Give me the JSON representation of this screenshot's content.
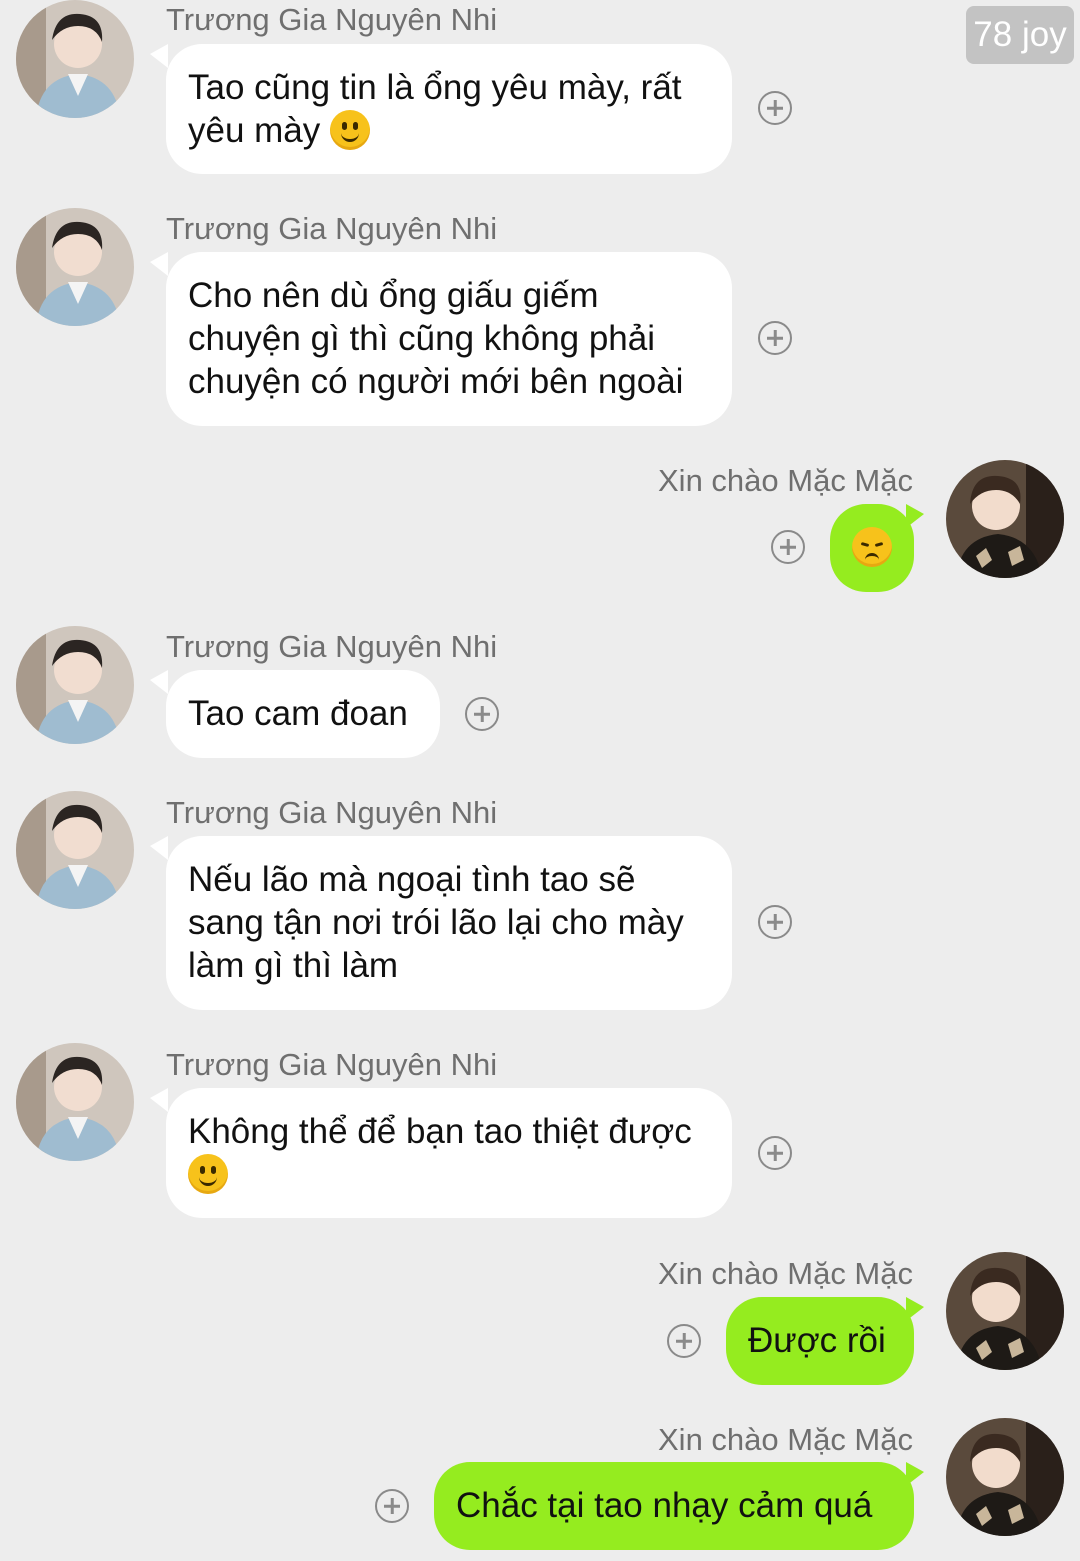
{
  "watermark": "78 joy",
  "colors": {
    "background": "#ededed",
    "incoming_bubble": "#ffffff",
    "outgoing_bubble": "#95ec1f"
  },
  "contacts": {
    "other": "Trương Gia Nguyên Nhi",
    "self": "Xin chào Mặc Mặc"
  },
  "messages": [
    {
      "sender": "Trương Gia Nguyên Nhi",
      "lines": [
        "Tao cũng tin là ổng yêu mày, rất",
        "yêu mày"
      ],
      "emoji": "slightly-smiling-face"
    },
    {
      "sender": "Trương Gia Nguyên Nhi",
      "lines": [
        "Cho nên dù ổng giấu giếm",
        "chuyện gì thì cũng không phải",
        "chuyện có người mới bên ngoài"
      ]
    },
    {
      "sender": "Xin chào Mặc Mặc",
      "lines": [],
      "emoji": "pensive-face"
    },
    {
      "sender": "Trương Gia Nguyên Nhi",
      "lines": [
        "Tao cam đoan"
      ]
    },
    {
      "sender": "Trương Gia Nguyên Nhi",
      "lines": [
        "Nếu lão mà ngoại tình tao sẽ",
        "sang tận nơi trói lão lại cho mày",
        "làm gì thì làm"
      ]
    },
    {
      "sender": "Trương Gia Nguyên Nhi",
      "lines": [
        "Không thể để bạn tao thiệt được"
      ],
      "emoji": "slightly-smiling-face"
    },
    {
      "sender": "Xin chào Mặc Mặc",
      "lines": [
        "Được rồi"
      ]
    },
    {
      "sender": "Xin chào Mặc Mặc",
      "lines": [
        "Chắc tại tao nhạy cảm quá"
      ]
    }
  ]
}
